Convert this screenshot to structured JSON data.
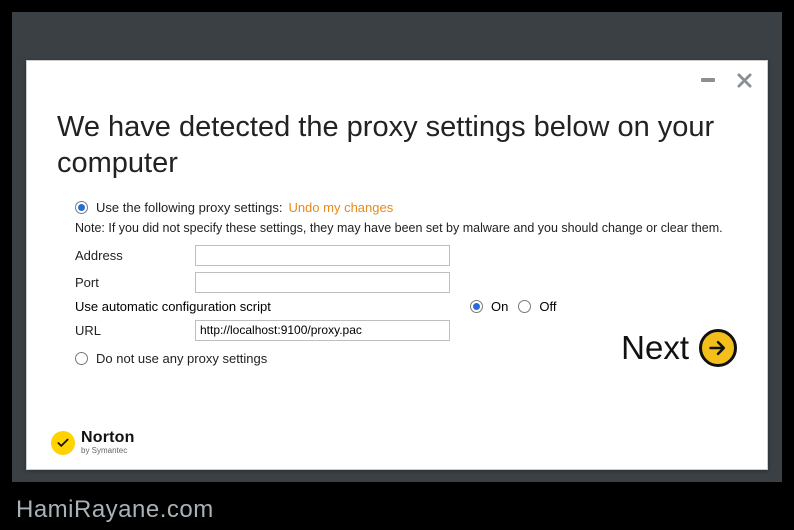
{
  "heading": "We have detected the proxy settings below on your computer",
  "proxy_mode": {
    "use_label": "Use the following proxy settings:",
    "undo_link": "Undo my changes",
    "none_label": "Do not use any proxy settings"
  },
  "note": "Note: If you did not specify these settings, they may have been set by malware and you should change or clear them.",
  "fields": {
    "address_label": "Address",
    "address_value": "",
    "port_label": "Port",
    "port_value": "",
    "auto_label": "Use automatic configuration script",
    "on_label": "On",
    "off_label": "Off",
    "url_label": "URL",
    "url_value": "http://localhost:9100/proxy.pac"
  },
  "next_label": "Next",
  "logo": {
    "brand": "Norton",
    "sub": "by Symantec"
  },
  "watermark": "HamiRayane.com"
}
